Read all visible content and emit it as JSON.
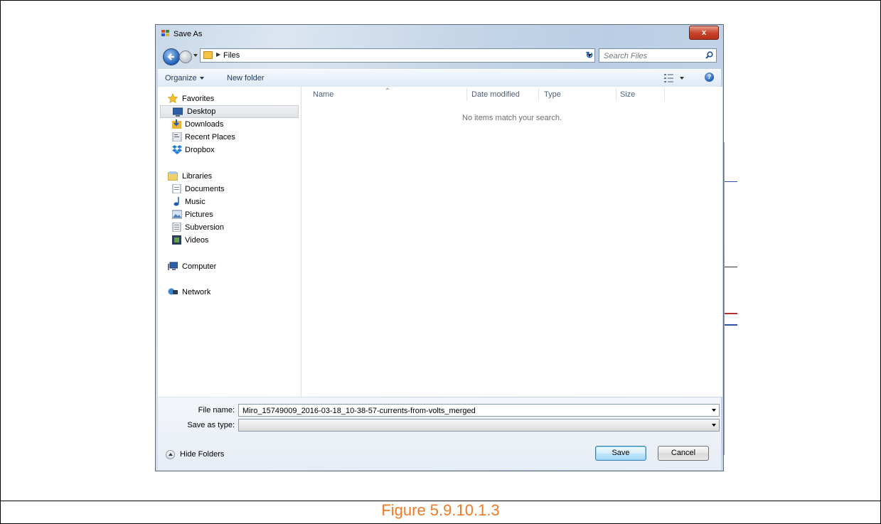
{
  "caption": "Figure 5.9.10.1.3",
  "dialog": {
    "title": "Save As",
    "close_label": "x",
    "address": {
      "crumb": "Files"
    },
    "search": {
      "placeholder": "Search Files"
    },
    "toolbar": {
      "organize": "Organize",
      "new_folder": "New folder"
    },
    "nav": {
      "favorites": "Favorites",
      "desktop": "Desktop",
      "downloads": "Downloads",
      "recent_places": "Recent Places",
      "dropbox": "Dropbox",
      "libraries": "Libraries",
      "documents": "Documents",
      "music": "Music",
      "pictures": "Pictures",
      "subversion": "Subversion",
      "videos": "Videos",
      "computer": "Computer",
      "network": "Network"
    },
    "columns": {
      "name": "Name",
      "date_modified": "Date modified",
      "type": "Type",
      "size": "Size"
    },
    "empty_message": "No items match your search.",
    "file_name_label": "File name:",
    "file_name_value": "Miro_15749009_2016-03-18_10-38-57-currents-from-volts_merged",
    "save_as_type_label": "Save as type:",
    "save_as_type_value": "",
    "hide_folders": "Hide Folders",
    "save_button": "Save",
    "cancel_button": "Cancel"
  }
}
